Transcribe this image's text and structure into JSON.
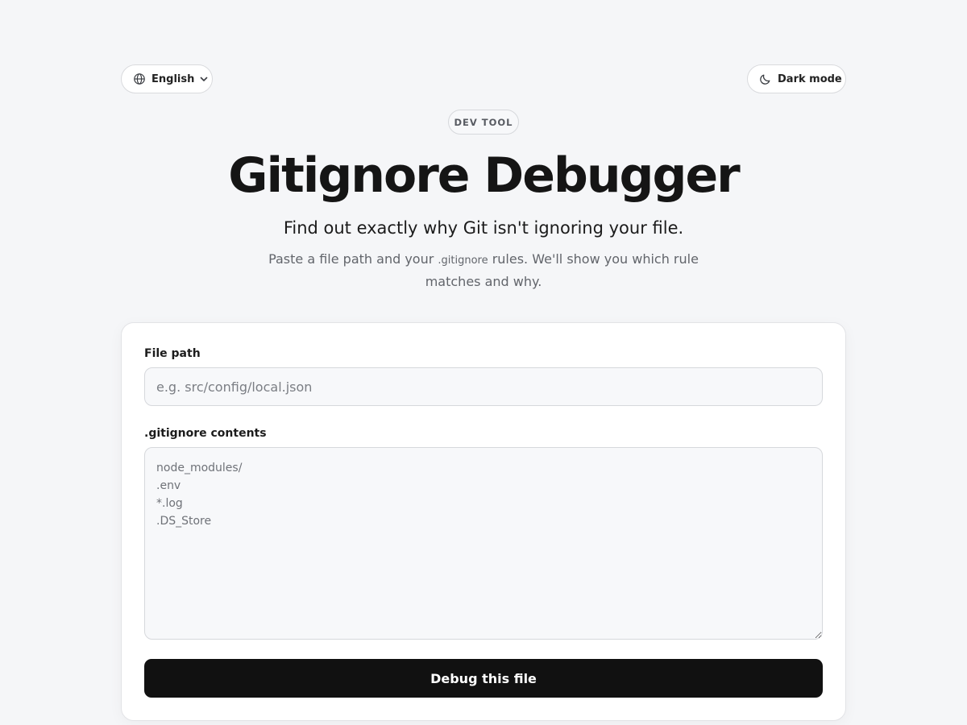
{
  "header": {
    "language_label": "English",
    "dark_mode_label": "Dark mode"
  },
  "hero": {
    "badge": "DEV TOOL",
    "title": "Gitignore Debugger",
    "subtitle": "Find out exactly why Git isn't ignoring your file.",
    "desc_before": "Paste a file path and your ",
    "desc_code": ".gitignore",
    "desc_after": " rules. We'll show you which rule matches and why."
  },
  "form": {
    "file_path_label": "File path",
    "file_path_placeholder": "e.g. src/config/local.json",
    "gitignore_label": ".gitignore contents",
    "gitignore_placeholder": "node_modules/\n.env\n*.log\n.DS_Store",
    "submit_label": "Debug this file"
  },
  "icons": {
    "language": "globe-icon",
    "dropdown": "chevron-down-icon",
    "dark_mode": "moon-icon"
  }
}
